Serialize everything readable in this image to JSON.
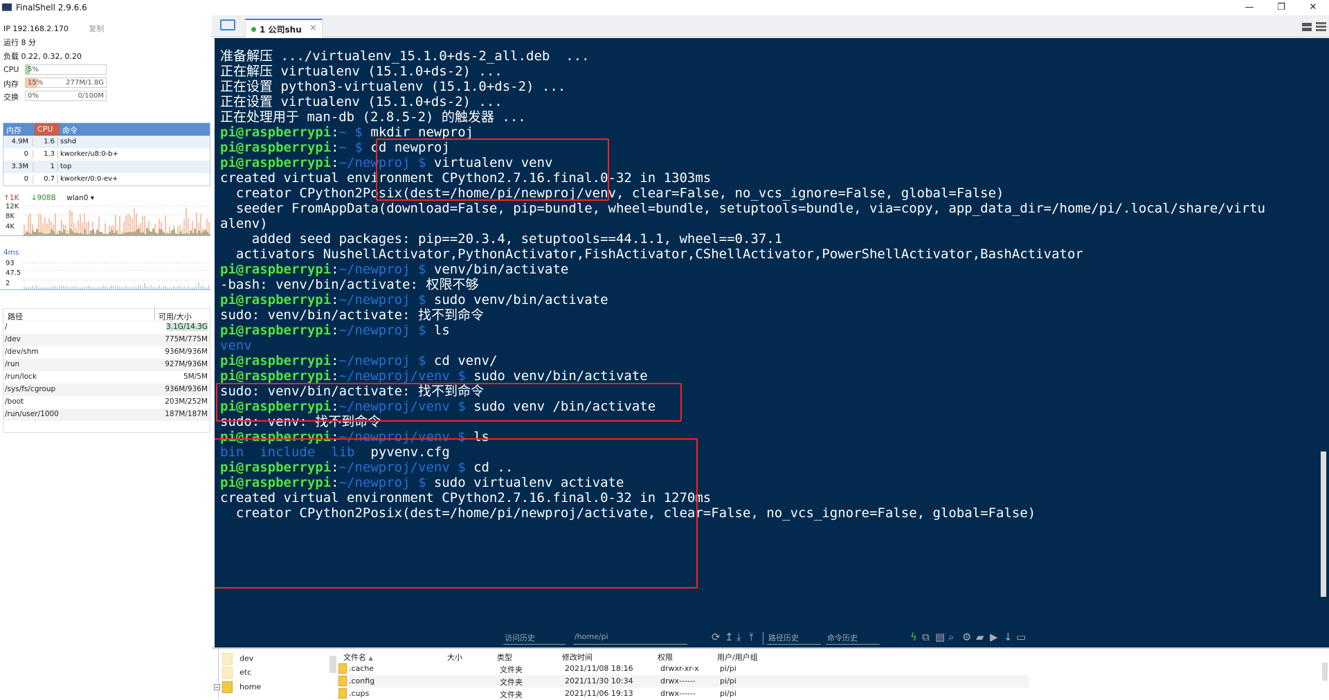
{
  "window": {
    "title": "FinalShell 2.9.6.6",
    "controls": {
      "minimize": "—",
      "restore": "❐",
      "close": "✕"
    }
  },
  "sidebar": {
    "ip_label": "IP 192.168.2.170",
    "copy_label": "复制",
    "uptime": "运行 8 分",
    "load": "负载 0.22, 0.32, 0.20",
    "meters": [
      {
        "label": "CPU",
        "percent_text": "5%",
        "fraction": 0.05,
        "value_text": "",
        "color": "#a8d8a0"
      },
      {
        "label": "内存",
        "percent_text": "15%",
        "fraction": 0.15,
        "value_text": "277M/1.8G",
        "color": "#f9c9a5"
      },
      {
        "label": "交换",
        "percent_text": "0%",
        "fraction": 0.0,
        "value_text": "0/100M",
        "color": "#cccccc"
      }
    ],
    "process_table": {
      "headers": {
        "mem": "内存",
        "cpu": "CPU",
        "cmd": "命令"
      },
      "header_colors": {
        "mem": "#5b8ed0",
        "cpu": "#c9604a"
      },
      "rows": [
        {
          "mem": "4.9M",
          "cpu": "1.6",
          "cmd": "sshd"
        },
        {
          "mem": "0",
          "cpu": "1.3",
          "cmd": "kworker/u8:0-b+"
        },
        {
          "mem": "3.3M",
          "cpu": "1",
          "cmd": "top"
        },
        {
          "mem": "0",
          "cpu": "0.7",
          "cmd": "kworker/0:0-ev+"
        }
      ]
    },
    "network": {
      "upload": "1K",
      "download": "908B",
      "interface": "wlan0",
      "y_ticks": [
        "12K",
        "8K",
        "4K"
      ]
    },
    "ping": {
      "latency": "4ms",
      "y_ticks": [
        "93",
        "47.5",
        "2"
      ]
    },
    "disk_table": {
      "headers": {
        "path": "路径",
        "avail": "可用/大小"
      },
      "rows": [
        {
          "path": "/",
          "avail": "3.1G/14.3G"
        },
        {
          "path": "/dev",
          "avail": "775M/775M"
        },
        {
          "path": "/dev/shm",
          "avail": "936M/936M"
        },
        {
          "path": "/run",
          "avail": "927M/936M"
        },
        {
          "path": "/run/lock",
          "avail": "5M/5M"
        },
        {
          "path": "/sys/fs/cgroup",
          "avail": "936M/936M"
        },
        {
          "path": "/boot",
          "avail": "203M/252M"
        },
        {
          "path": "/run/user/1000",
          "avail": "187M/187M"
        }
      ]
    }
  },
  "tabs": {
    "active_tab": {
      "label": "1 公司shu",
      "status_color": "#22b14c"
    },
    "close_glyph": "×"
  },
  "terminal": {
    "prompt_user": "pi@raspberrypi",
    "lines": [
      {
        "type": "out",
        "text": "准备解压 .../virtualenv_15.1.0+ds-2_all.deb  ..."
      },
      {
        "type": "out",
        "text": "正在解压 virtualenv (15.1.0+ds-2) ..."
      },
      {
        "type": "out",
        "text": "正在设置 python3-virtualenv (15.1.0+ds-2) ..."
      },
      {
        "type": "out",
        "text": "正在设置 virtualenv (15.1.0+ds-2) ..."
      },
      {
        "type": "out",
        "text": "正在处理用于 man-db (2.8.5-2) 的触发器 ..."
      },
      {
        "type": "cmd",
        "path": "~",
        "cmd": "mkdir newproj"
      },
      {
        "type": "cmd",
        "path": "~",
        "cmd": "cd newproj"
      },
      {
        "type": "cmd",
        "path": "~/newproj",
        "cmd": "virtualenv venv"
      },
      {
        "type": "out",
        "text": "created virtual environment CPython2.7.16.final.0-32 in 1303ms"
      },
      {
        "type": "out",
        "text": "  creator CPython2Posix(dest=/home/pi/newproj/venv, clear=False, no_vcs_ignore=False, global=False)"
      },
      {
        "type": "out",
        "text": "  seeder FromAppData(download=False, pip=bundle, wheel=bundle, setuptools=bundle, via=copy, app_data_dir=/home/pi/.local/share/virtu"
      },
      {
        "type": "out",
        "text": "alenv)"
      },
      {
        "type": "out",
        "text": "    added seed packages: pip==20.3.4, setuptools==44.1.1, wheel==0.37.1"
      },
      {
        "type": "out",
        "text": "  activators NushellActivator,PythonActivator,FishActivator,CShellActivator,PowerShellActivator,BashActivator"
      },
      {
        "type": "cmd",
        "path": "~/newproj",
        "cmd": "venv/bin/activate"
      },
      {
        "type": "out",
        "text": "-bash: venv/bin/activate: 权限不够"
      },
      {
        "type": "cmd",
        "path": "~/newproj",
        "cmd": "sudo venv/bin/activate"
      },
      {
        "type": "out",
        "text": "sudo: venv/bin/activate: 找不到命令"
      },
      {
        "type": "cmd",
        "path": "~/newproj",
        "cmd": "ls"
      },
      {
        "type": "dir",
        "text": "venv"
      },
      {
        "type": "cmd",
        "path": "~/newproj",
        "cmd": "cd venv/"
      },
      {
        "type": "cmd",
        "path": "~/newproj/venv",
        "cmd": "sudo venv/bin/activate"
      },
      {
        "type": "out",
        "text": "sudo: venv/bin/activate: 找不到命令"
      },
      {
        "type": "cmd",
        "path": "~/newproj/venv",
        "cmd": "sudo venv /bin/activate"
      },
      {
        "type": "out",
        "text": "sudo: venv: 找不到命令"
      },
      {
        "type": "cmd",
        "path": "~/newproj/venv",
        "cmd": "ls"
      },
      {
        "type": "ls",
        "dirs": [
          "bin",
          "include",
          "lib"
        ],
        "files": [
          "pyvenv.cfg"
        ]
      },
      {
        "type": "cmd",
        "path": "~/newproj/venv",
        "cmd": "cd .."
      },
      {
        "type": "cmd",
        "path": "~/newproj",
        "cmd": "sudo virtualenv activate"
      },
      {
        "type": "out",
        "text": "created virtual environment CPython2.7.16.final.0-32 in 1270ms"
      },
      {
        "type": "out",
        "text": "  creator CPython2Posix(dest=/home/pi/newproj/activate, clear=False, no_vcs_ignore=False, global=False)"
      }
    ],
    "highlight_color": "#ff2020"
  },
  "toolbar": {
    "visit_history": "访问历史",
    "current_path": "/home/pi",
    "path_history": "路径历史",
    "command_history": "命令历史",
    "icons": [
      "refresh-icon",
      "up-icon",
      "download-icon",
      "upload-icon"
    ],
    "right_icons": [
      "lightning-icon",
      "copy-icon",
      "paste-icon",
      "search-icon",
      "gear-icon",
      "folder-open-icon",
      "play-icon",
      "arrow-down-icon",
      "window-icon"
    ]
  },
  "file_browser": {
    "tree": [
      {
        "name": "dev"
      },
      {
        "name": "etc"
      },
      {
        "name": "home",
        "expanded": true
      }
    ],
    "headers": {
      "name": "文件名",
      "size": "大小",
      "type": "类型",
      "mtime": "修改时间",
      "perm": "权限",
      "owner": "用户/用户组"
    },
    "rows": [
      {
        "name": ".cache",
        "size": "",
        "type": "文件夹",
        "mtime": "2021/11/08 18:16",
        "perm": "drwxr-xr-x",
        "owner": "pi/pi"
      },
      {
        "name": ".config",
        "size": "",
        "type": "文件夹",
        "mtime": "2021/11/30 10:34",
        "perm": "drwx------",
        "owner": "pi/pi"
      },
      {
        "name": ".cups",
        "size": "",
        "type": "文件夹",
        "mtime": "2021/11/06 19:13",
        "perm": "drwx------",
        "owner": "pi/pi"
      }
    ]
  }
}
